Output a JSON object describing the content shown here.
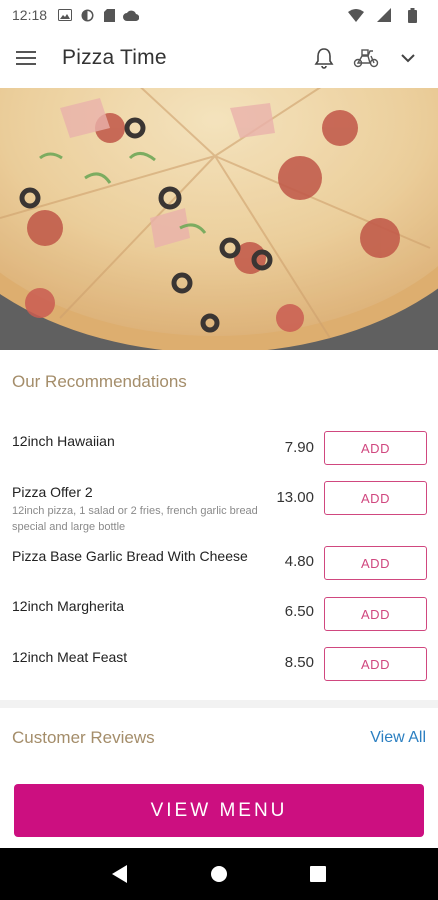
{
  "status_bar": {
    "time": "12:18"
  },
  "app_bar": {
    "title": "Pizza Time"
  },
  "recommendations": {
    "title": "Our Recommendations",
    "items": [
      {
        "name": "12inch Hawaiian",
        "description": "",
        "price": "7.90",
        "button": "ADD"
      },
      {
        "name": "Pizza Offer 2",
        "description": "12inch pizza, 1 salad or 2 fries, french garlic bread special and large bottle",
        "price": "13.00",
        "button": "ADD"
      },
      {
        "name": "Pizza Base Garlic Bread With Cheese",
        "description": "",
        "price": "4.80",
        "button": "ADD"
      },
      {
        "name": "12inch Margherita",
        "description": "",
        "price": "6.50",
        "button": "ADD"
      },
      {
        "name": "12inch Meat Feast",
        "description": "",
        "price": "8.50",
        "button": "ADD"
      }
    ]
  },
  "reviews": {
    "title": "Customer Reviews",
    "view_all": "View All"
  },
  "view_menu_label": "VIEW MENU",
  "colors": {
    "accent": "#cc0f80",
    "add_border": "#d0477f",
    "section_title": "#a48d6a",
    "link": "#2b7fc1"
  }
}
